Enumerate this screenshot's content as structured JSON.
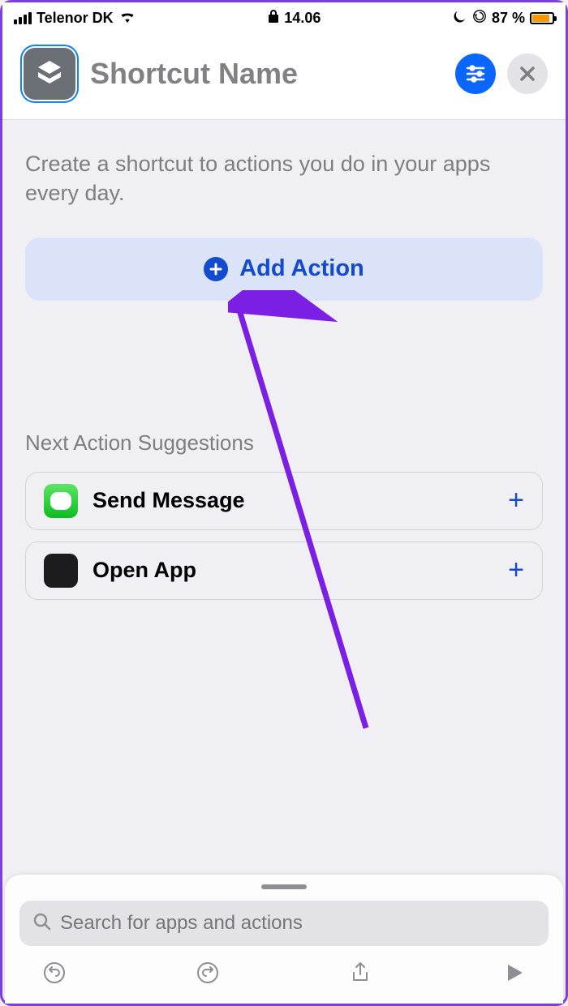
{
  "status": {
    "carrier": "Telenor DK",
    "time": "14.06",
    "battery_pct": "87 %"
  },
  "header": {
    "title": "Shortcut Name"
  },
  "content": {
    "intro": "Create a shortcut to actions you do in your apps every day.",
    "add_action_label": "Add Action",
    "suggestions_header": "Next Action Suggestions",
    "suggestions": [
      {
        "label": "Send Message"
      },
      {
        "label": "Open App"
      }
    ]
  },
  "sheet": {
    "search_placeholder": "Search for apps and actions"
  }
}
